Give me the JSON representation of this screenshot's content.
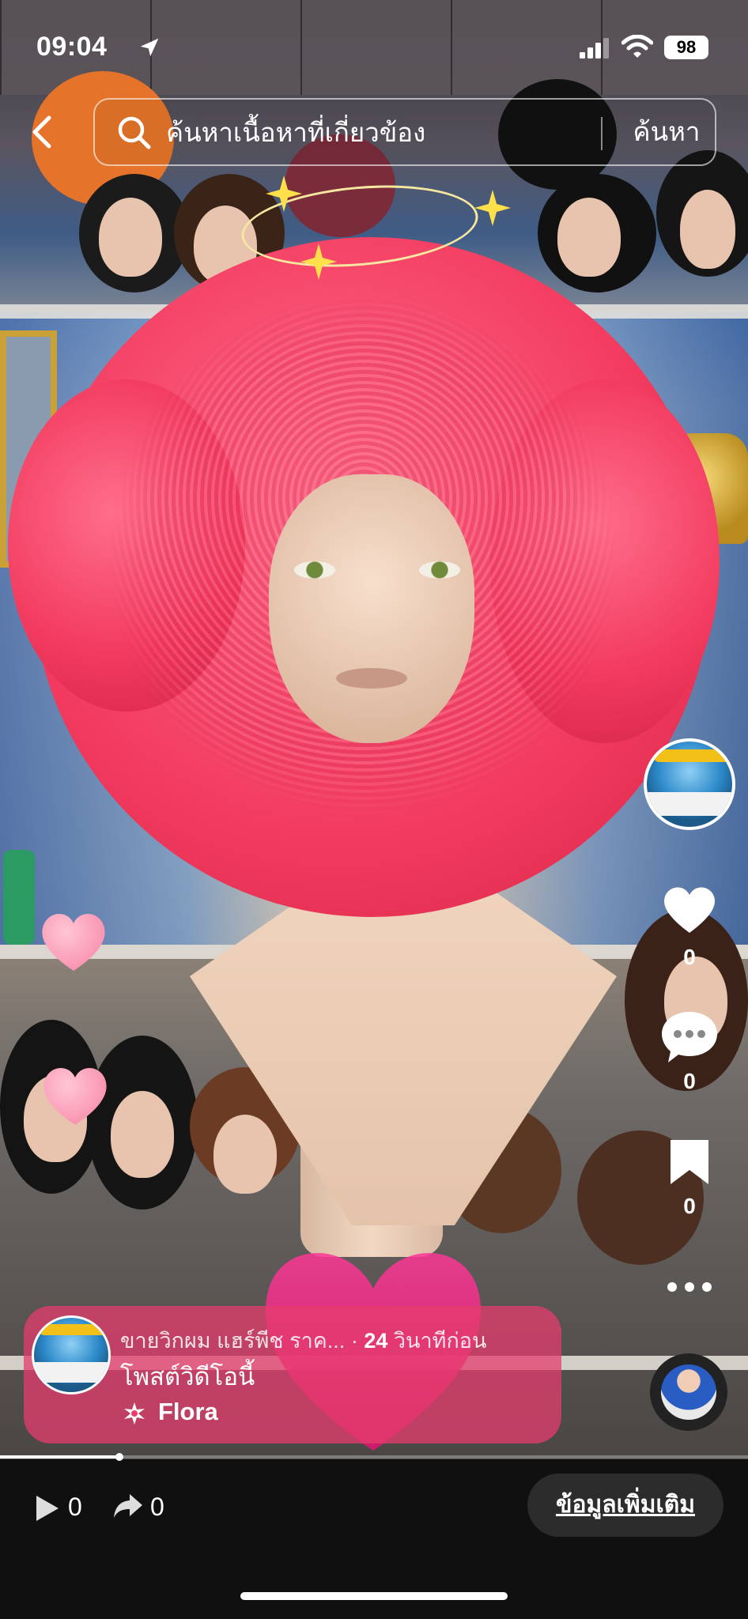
{
  "status_bar": {
    "time": "09:04",
    "battery": "98"
  },
  "search": {
    "placeholder": "ค้นหาเนื้อหาที่เกี่ยวข้อง",
    "button": "ค้นหา"
  },
  "actions": {
    "likes": "0",
    "comments": "0",
    "saves": "0"
  },
  "post": {
    "author": "ขายวิกผม แฮร์พีช ราค...",
    "separator": " · ",
    "time_number": "24",
    "time_unit": " วินาทีก่อน",
    "title": "โพสต์วิดีโอนี้",
    "music": "Flora"
  },
  "progress": {
    "fraction": 0.16
  },
  "bottom": {
    "plays": "0",
    "shares": "0",
    "more_info": "ข้อมูลเพิ่มเติม"
  },
  "icons": [
    "back-icon",
    "search-icon",
    "location-arrow-icon",
    "signal-icon",
    "wifi-icon",
    "heart-icon",
    "comment-icon",
    "bookmark-icon",
    "more-icon",
    "music-icon",
    "play-icon",
    "share-icon"
  ],
  "colors": {
    "card": "#e63c6e",
    "bar": "#101010",
    "button": "#2c2c2c"
  }
}
